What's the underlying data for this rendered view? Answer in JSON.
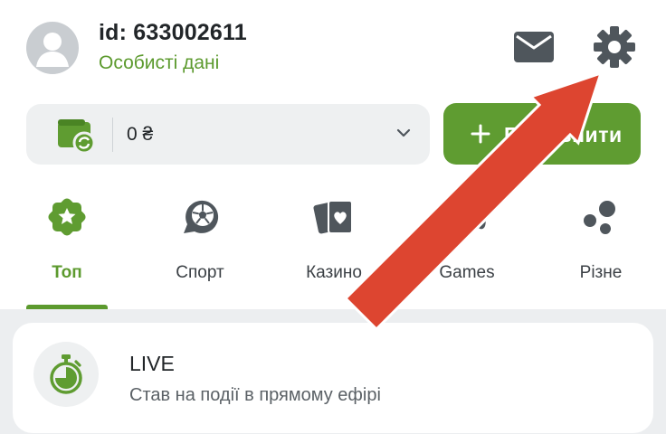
{
  "header": {
    "user_id": "id: 633002611",
    "personal_data_link": "Особисті дані",
    "icons": [
      "avatar-icon",
      "mail-icon",
      "gear-icon"
    ]
  },
  "balance": {
    "value": "0 ₴",
    "deposit_label": "Поповнити",
    "icons": [
      "wallet-icon",
      "chevron-down-icon",
      "plus-icon"
    ]
  },
  "tabs": [
    {
      "label": "Топ",
      "icon": "star-badge-icon",
      "active": true
    },
    {
      "label": "Спорт",
      "icon": "soccer-ball-icon",
      "active": false
    },
    {
      "label": "Казино",
      "icon": "playing-cards-icon",
      "active": false
    },
    {
      "label": "Games",
      "icon": "gamepad-icon",
      "active": false
    },
    {
      "label": "Різне",
      "icon": "bubbles-icon",
      "active": false
    }
  ],
  "live": {
    "title": "LIVE",
    "subtitle": "Став на події в прямому ефірі",
    "icon": "stopwatch-icon"
  },
  "colors": {
    "accent_green": "#5f9c31",
    "text_dark": "#222629",
    "icon_gray": "#4f565c",
    "annotation_arrow": "#dd4530"
  }
}
